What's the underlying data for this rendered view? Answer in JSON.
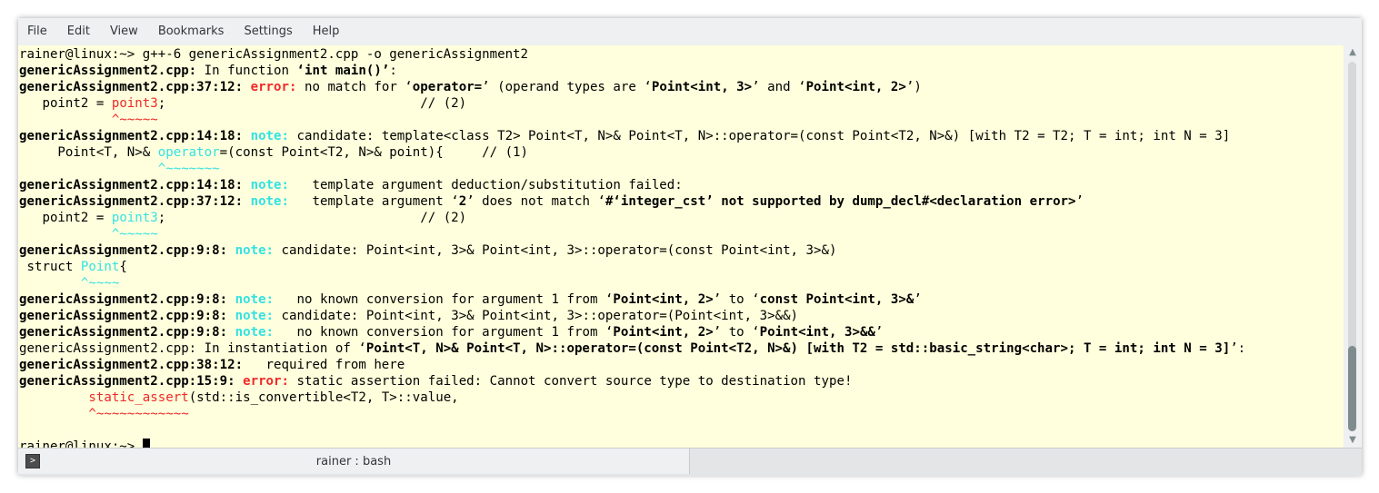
{
  "menu": [
    "File",
    "Edit",
    "View",
    "Bookmarks",
    "Settings",
    "Help"
  ],
  "terminal": {
    "lines": [
      [
        {
          "t": "rainer@linux:~> g++-6 genericAssignment2.cpp -o genericAssignment2"
        }
      ],
      [
        {
          "t": "genericAssignment2.cpp:",
          "s": "b"
        },
        {
          "t": " In function "
        },
        {
          "t": "‘int main()’",
          "s": "b"
        },
        {
          "t": ":"
        }
      ],
      [
        {
          "t": "genericAssignment2.cpp:37:12:",
          "s": "b"
        },
        {
          "t": " "
        },
        {
          "t": "error:",
          "s": "err"
        },
        {
          "t": " no match for ‘"
        },
        {
          "t": "operator=",
          "s": "b"
        },
        {
          "t": "’ (operand types are ‘"
        },
        {
          "t": "Point<int, 3>",
          "s": "b"
        },
        {
          "t": "’ and ‘"
        },
        {
          "t": "Point<int, 2>",
          "s": "b"
        },
        {
          "t": "’)"
        }
      ],
      [
        {
          "t": "   point2 = "
        },
        {
          "t": "point3",
          "s": "red"
        },
        {
          "t": ";                                 // (2)"
        }
      ],
      [
        {
          "t": "            "
        },
        {
          "t": "^~~~~~",
          "s": "red"
        }
      ],
      [
        {
          "t": "genericAssignment2.cpp:14:18:",
          "s": "b"
        },
        {
          "t": " "
        },
        {
          "t": "note:",
          "s": "note"
        },
        {
          "t": " candidate: template<class T2> Point<T, N>& Point<T, N>::operator=(const Point<T2, N>&) [with T2 = T2; T = int; int N = 3]"
        }
      ],
      [
        {
          "t": "     Point<T, N>& "
        },
        {
          "t": "operator",
          "s": "cyan"
        },
        {
          "t": "=(const Point<T2, N>& point){     // (1)"
        }
      ],
      [
        {
          "t": "                  "
        },
        {
          "t": "^~~~~~~~",
          "s": "cyan"
        }
      ],
      [
        {
          "t": "genericAssignment2.cpp:14:18:",
          "s": "b"
        },
        {
          "t": " "
        },
        {
          "t": "note:",
          "s": "note"
        },
        {
          "t": "   template argument deduction/substitution failed:"
        }
      ],
      [
        {
          "t": "genericAssignment2.cpp:37:12:",
          "s": "b"
        },
        {
          "t": " "
        },
        {
          "t": "note:",
          "s": "note"
        },
        {
          "t": "   template argument ‘"
        },
        {
          "t": "2",
          "s": "b"
        },
        {
          "t": "’ does not match ‘"
        },
        {
          "t": "#‘integer_cst’ not supported by dump_decl#<declaration error>",
          "s": "b"
        },
        {
          "t": "’"
        }
      ],
      [
        {
          "t": "   point2 = "
        },
        {
          "t": "point3",
          "s": "cyan"
        },
        {
          "t": ";                                 // (2)"
        }
      ],
      [
        {
          "t": "            "
        },
        {
          "t": "^~~~~~",
          "s": "cyan"
        }
      ],
      [
        {
          "t": "genericAssignment2.cpp:9:8:",
          "s": "b"
        },
        {
          "t": " "
        },
        {
          "t": "note:",
          "s": "note"
        },
        {
          "t": " candidate: Point<int, 3>& Point<int, 3>::operator=(const Point<int, 3>&)"
        }
      ],
      [
        {
          "t": " struct "
        },
        {
          "t": "Point",
          "s": "cyan"
        },
        {
          "t": "{"
        }
      ],
      [
        {
          "t": "        "
        },
        {
          "t": "^~~~~",
          "s": "cyan"
        }
      ],
      [
        {
          "t": "genericAssignment2.cpp:9:8:",
          "s": "b"
        },
        {
          "t": " "
        },
        {
          "t": "note:",
          "s": "note"
        },
        {
          "t": "   no known conversion for argument 1 from ‘"
        },
        {
          "t": "Point<int, 2>",
          "s": "b"
        },
        {
          "t": "’ to ‘"
        },
        {
          "t": "const Point<int, 3>&",
          "s": "b"
        },
        {
          "t": "’"
        }
      ],
      [
        {
          "t": "genericAssignment2.cpp:9:8:",
          "s": "b"
        },
        {
          "t": " "
        },
        {
          "t": "note:",
          "s": "note"
        },
        {
          "t": " candidate: Point<int, 3>& Point<int, 3>::operator=(Point<int, 3>&&)"
        }
      ],
      [
        {
          "t": "genericAssignment2.cpp:9:8:",
          "s": "b"
        },
        {
          "t": " "
        },
        {
          "t": "note:",
          "s": "note"
        },
        {
          "t": "   no known conversion for argument 1 from ‘"
        },
        {
          "t": "Point<int, 2>",
          "s": "b"
        },
        {
          "t": "’ to ‘"
        },
        {
          "t": "Point<int, 3>&&",
          "s": "b"
        },
        {
          "t": "’"
        }
      ],
      [
        {
          "t": "genericAssignment2.cpp: In instantiation of ‘"
        },
        {
          "t": "Point<T, N>& Point<T, N>::operator=(const Point<T2, N>&) [with T2 = std::basic_string<char>; T = int; int N = 3]",
          "s": "b"
        },
        {
          "t": "’:"
        }
      ],
      [
        {
          "t": "genericAssignment2.cpp:38:12:",
          "s": "b"
        },
        {
          "t": "   required from here"
        }
      ],
      [
        {
          "t": "genericAssignment2.cpp:15:9:",
          "s": "b"
        },
        {
          "t": " "
        },
        {
          "t": "error:",
          "s": "err"
        },
        {
          "t": " static assertion failed: Cannot convert source type to destination type!"
        }
      ],
      [
        {
          "t": "         "
        },
        {
          "t": "static_assert",
          "s": "red"
        },
        {
          "t": "(std::is_convertible<T2, T>::value,"
        }
      ],
      [
        {
          "t": "         "
        },
        {
          "t": "^~~~~~~~~~~~~",
          "s": "red"
        }
      ],
      [
        {
          "t": ""
        }
      ],
      [
        {
          "t": "rainer@linux:~> "
        }
      ]
    ]
  },
  "scrollbar": {
    "thumb_start_fraction": 0.77,
    "thumb_end_fraction": 1.0
  },
  "tab": {
    "label": "rainer : bash",
    "icon": "terminal-icon"
  },
  "colors": {
    "background": "#ffffdd",
    "error": "#ef2929",
    "note": "#34e2e2",
    "foreground": "#000000"
  }
}
